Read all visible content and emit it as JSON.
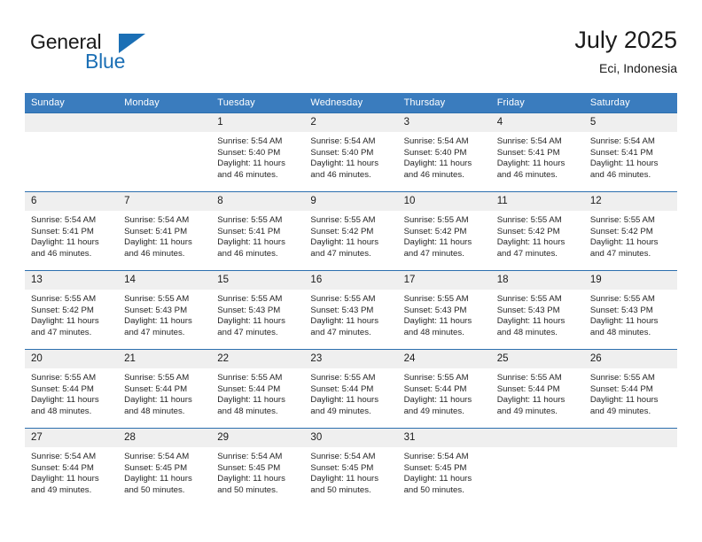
{
  "brand": {
    "name_top": "General",
    "name_bottom": "Blue",
    "flag_color": "#1b6fb5"
  },
  "header": {
    "title": "July 2025",
    "subtitle": "Eci, Indonesia"
  },
  "theme": {
    "header_blue": "#3a7cbe",
    "row_rule_blue": "#2c6fae",
    "date_band_gray": "#efefef"
  },
  "weekdays": [
    "Sunday",
    "Monday",
    "Tuesday",
    "Wednesday",
    "Thursday",
    "Friday",
    "Saturday"
  ],
  "weeks": [
    [
      {
        "day": "",
        "sunrise": "",
        "sunset": "",
        "daylight1": "",
        "daylight2": ""
      },
      {
        "day": "",
        "sunrise": "",
        "sunset": "",
        "daylight1": "",
        "daylight2": ""
      },
      {
        "day": "1",
        "sunrise": "Sunrise: 5:54 AM",
        "sunset": "Sunset: 5:40 PM",
        "daylight1": "Daylight: 11 hours",
        "daylight2": "and 46 minutes."
      },
      {
        "day": "2",
        "sunrise": "Sunrise: 5:54 AM",
        "sunset": "Sunset: 5:40 PM",
        "daylight1": "Daylight: 11 hours",
        "daylight2": "and 46 minutes."
      },
      {
        "day": "3",
        "sunrise": "Sunrise: 5:54 AM",
        "sunset": "Sunset: 5:40 PM",
        "daylight1": "Daylight: 11 hours",
        "daylight2": "and 46 minutes."
      },
      {
        "day": "4",
        "sunrise": "Sunrise: 5:54 AM",
        "sunset": "Sunset: 5:41 PM",
        "daylight1": "Daylight: 11 hours",
        "daylight2": "and 46 minutes."
      },
      {
        "day": "5",
        "sunrise": "Sunrise: 5:54 AM",
        "sunset": "Sunset: 5:41 PM",
        "daylight1": "Daylight: 11 hours",
        "daylight2": "and 46 minutes."
      }
    ],
    [
      {
        "day": "6",
        "sunrise": "Sunrise: 5:54 AM",
        "sunset": "Sunset: 5:41 PM",
        "daylight1": "Daylight: 11 hours",
        "daylight2": "and 46 minutes."
      },
      {
        "day": "7",
        "sunrise": "Sunrise: 5:54 AM",
        "sunset": "Sunset: 5:41 PM",
        "daylight1": "Daylight: 11 hours",
        "daylight2": "and 46 minutes."
      },
      {
        "day": "8",
        "sunrise": "Sunrise: 5:55 AM",
        "sunset": "Sunset: 5:41 PM",
        "daylight1": "Daylight: 11 hours",
        "daylight2": "and 46 minutes."
      },
      {
        "day": "9",
        "sunrise": "Sunrise: 5:55 AM",
        "sunset": "Sunset: 5:42 PM",
        "daylight1": "Daylight: 11 hours",
        "daylight2": "and 47 minutes."
      },
      {
        "day": "10",
        "sunrise": "Sunrise: 5:55 AM",
        "sunset": "Sunset: 5:42 PM",
        "daylight1": "Daylight: 11 hours",
        "daylight2": "and 47 minutes."
      },
      {
        "day": "11",
        "sunrise": "Sunrise: 5:55 AM",
        "sunset": "Sunset: 5:42 PM",
        "daylight1": "Daylight: 11 hours",
        "daylight2": "and 47 minutes."
      },
      {
        "day": "12",
        "sunrise": "Sunrise: 5:55 AM",
        "sunset": "Sunset: 5:42 PM",
        "daylight1": "Daylight: 11 hours",
        "daylight2": "and 47 minutes."
      }
    ],
    [
      {
        "day": "13",
        "sunrise": "Sunrise: 5:55 AM",
        "sunset": "Sunset: 5:42 PM",
        "daylight1": "Daylight: 11 hours",
        "daylight2": "and 47 minutes."
      },
      {
        "day": "14",
        "sunrise": "Sunrise: 5:55 AM",
        "sunset": "Sunset: 5:43 PM",
        "daylight1": "Daylight: 11 hours",
        "daylight2": "and 47 minutes."
      },
      {
        "day": "15",
        "sunrise": "Sunrise: 5:55 AM",
        "sunset": "Sunset: 5:43 PM",
        "daylight1": "Daylight: 11 hours",
        "daylight2": "and 47 minutes."
      },
      {
        "day": "16",
        "sunrise": "Sunrise: 5:55 AM",
        "sunset": "Sunset: 5:43 PM",
        "daylight1": "Daylight: 11 hours",
        "daylight2": "and 47 minutes."
      },
      {
        "day": "17",
        "sunrise": "Sunrise: 5:55 AM",
        "sunset": "Sunset: 5:43 PM",
        "daylight1": "Daylight: 11 hours",
        "daylight2": "and 48 minutes."
      },
      {
        "day": "18",
        "sunrise": "Sunrise: 5:55 AM",
        "sunset": "Sunset: 5:43 PM",
        "daylight1": "Daylight: 11 hours",
        "daylight2": "and 48 minutes."
      },
      {
        "day": "19",
        "sunrise": "Sunrise: 5:55 AM",
        "sunset": "Sunset: 5:43 PM",
        "daylight1": "Daylight: 11 hours",
        "daylight2": "and 48 minutes."
      }
    ],
    [
      {
        "day": "20",
        "sunrise": "Sunrise: 5:55 AM",
        "sunset": "Sunset: 5:44 PM",
        "daylight1": "Daylight: 11 hours",
        "daylight2": "and 48 minutes."
      },
      {
        "day": "21",
        "sunrise": "Sunrise: 5:55 AM",
        "sunset": "Sunset: 5:44 PM",
        "daylight1": "Daylight: 11 hours",
        "daylight2": "and 48 minutes."
      },
      {
        "day": "22",
        "sunrise": "Sunrise: 5:55 AM",
        "sunset": "Sunset: 5:44 PM",
        "daylight1": "Daylight: 11 hours",
        "daylight2": "and 48 minutes."
      },
      {
        "day": "23",
        "sunrise": "Sunrise: 5:55 AM",
        "sunset": "Sunset: 5:44 PM",
        "daylight1": "Daylight: 11 hours",
        "daylight2": "and 49 minutes."
      },
      {
        "day": "24",
        "sunrise": "Sunrise: 5:55 AM",
        "sunset": "Sunset: 5:44 PM",
        "daylight1": "Daylight: 11 hours",
        "daylight2": "and 49 minutes."
      },
      {
        "day": "25",
        "sunrise": "Sunrise: 5:55 AM",
        "sunset": "Sunset: 5:44 PM",
        "daylight1": "Daylight: 11 hours",
        "daylight2": "and 49 minutes."
      },
      {
        "day": "26",
        "sunrise": "Sunrise: 5:55 AM",
        "sunset": "Sunset: 5:44 PM",
        "daylight1": "Daylight: 11 hours",
        "daylight2": "and 49 minutes."
      }
    ],
    [
      {
        "day": "27",
        "sunrise": "Sunrise: 5:54 AM",
        "sunset": "Sunset: 5:44 PM",
        "daylight1": "Daylight: 11 hours",
        "daylight2": "and 49 minutes."
      },
      {
        "day": "28",
        "sunrise": "Sunrise: 5:54 AM",
        "sunset": "Sunset: 5:45 PM",
        "daylight1": "Daylight: 11 hours",
        "daylight2": "and 50 minutes."
      },
      {
        "day": "29",
        "sunrise": "Sunrise: 5:54 AM",
        "sunset": "Sunset: 5:45 PM",
        "daylight1": "Daylight: 11 hours",
        "daylight2": "and 50 minutes."
      },
      {
        "day": "30",
        "sunrise": "Sunrise: 5:54 AM",
        "sunset": "Sunset: 5:45 PM",
        "daylight1": "Daylight: 11 hours",
        "daylight2": "and 50 minutes."
      },
      {
        "day": "31",
        "sunrise": "Sunrise: 5:54 AM",
        "sunset": "Sunset: 5:45 PM",
        "daylight1": "Daylight: 11 hours",
        "daylight2": "and 50 minutes."
      },
      {
        "day": "",
        "sunrise": "",
        "sunset": "",
        "daylight1": "",
        "daylight2": ""
      },
      {
        "day": "",
        "sunrise": "",
        "sunset": "",
        "daylight1": "",
        "daylight2": ""
      }
    ]
  ]
}
